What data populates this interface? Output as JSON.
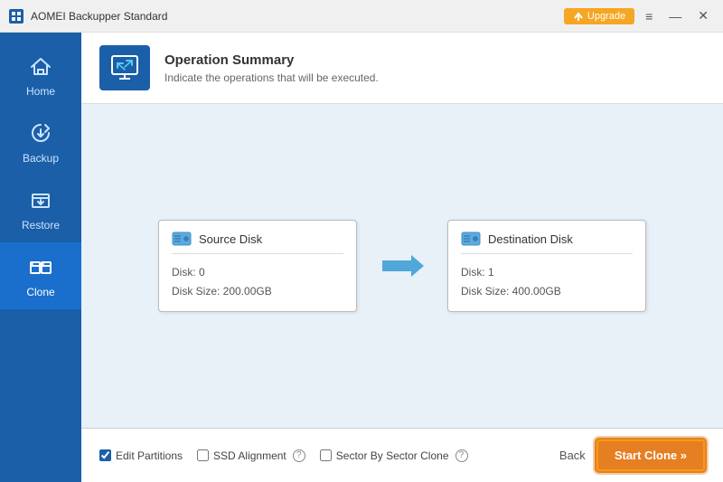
{
  "titleBar": {
    "title": "AOMEI Backupper Standard",
    "upgradeLabel": "Upgrade",
    "menuIcon": "≡",
    "minimizeLabel": "—",
    "closeLabel": "✕"
  },
  "sidebar": {
    "items": [
      {
        "id": "home",
        "label": "Home",
        "active": false
      },
      {
        "id": "backup",
        "label": "Backup",
        "active": false
      },
      {
        "id": "restore",
        "label": "Restore",
        "active": false
      },
      {
        "id": "clone",
        "label": "Clone",
        "active": true
      }
    ]
  },
  "operationSummary": {
    "title": "Operation Summary",
    "subtitle": "Indicate the operations that will be executed."
  },
  "sourceDisk": {
    "label": "Source Disk",
    "diskNumber": "Disk: 0",
    "diskSize": "Disk Size: 200.00GB"
  },
  "destinationDisk": {
    "label": "Destination Disk",
    "diskNumber": "Disk: 1",
    "diskSize": "Disk Size: 400.00GB"
  },
  "bottomBar": {
    "editPartitionsLabel": "Edit Partitions",
    "ssdAlignmentLabel": "SSD Alignment",
    "sectorBySectorLabel": "Sector By Sector Clone",
    "backLabel": "Back",
    "startCloneLabel": "Start Clone »"
  },
  "colors": {
    "primary": "#1a5fa8",
    "accent": "#e67e22",
    "arrowBlue": "#4fa8d8"
  }
}
